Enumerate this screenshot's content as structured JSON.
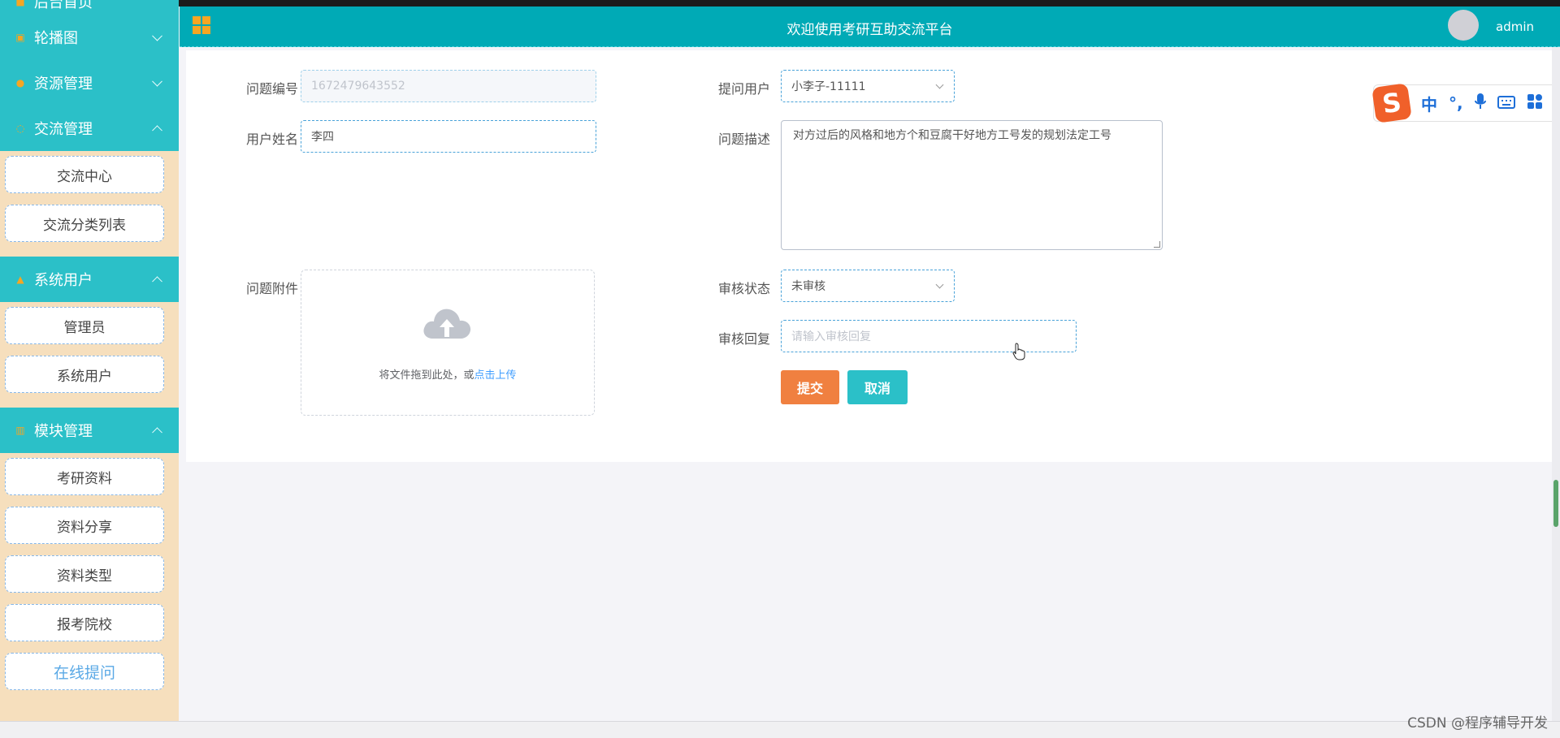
{
  "header": {
    "title": "欢迎使用考研互助交流平台",
    "username": "admin"
  },
  "sidebar": {
    "partial_top_label": "后台首页",
    "groups": [
      {
        "label": "轮播图",
        "icon": "image-icon",
        "expanded": false,
        "items": []
      },
      {
        "label": "资源管理",
        "icon": "location-pin-icon",
        "expanded": false,
        "items": []
      },
      {
        "label": "交流管理",
        "icon": "chat-icon",
        "expanded": true,
        "items": [
          "交流中心",
          "交流分类列表"
        ]
      },
      {
        "label": "系统用户",
        "icon": "user-icon",
        "expanded": true,
        "items": [
          "管理员",
          "系统用户"
        ]
      },
      {
        "label": "模块管理",
        "icon": "module-icon",
        "expanded": true,
        "items": [
          "考研资料",
          "资料分享",
          "资料类型",
          "报考院校",
          "在线提问"
        ]
      }
    ],
    "active_item": "在线提问"
  },
  "form": {
    "question_id": {
      "label": "问题编号",
      "value": "1672479643552"
    },
    "asker": {
      "label": "提问用户",
      "value": "小李子-11111"
    },
    "user_name": {
      "label": "用户姓名",
      "value": "李四"
    },
    "description": {
      "label": "问题描述",
      "value": "对方过后的风格和地方个和豆腐干好地方工号发的规划法定工号"
    },
    "attachment": {
      "label": "问题附件",
      "upload_text": "将文件拖到此处，或",
      "upload_link": "点击上传"
    },
    "review_status": {
      "label": "审核状态",
      "value": "未审核"
    },
    "review_reply": {
      "label": "审核回复",
      "placeholder": "请输入审核回复"
    },
    "submit_label": "提交",
    "cancel_label": "取消"
  },
  "ime": {
    "logo": "S",
    "buttons": [
      "中",
      "°,",
      "mic-icon",
      "keyboard-icon",
      "grid-icon"
    ]
  },
  "watermark": "CSDN @程序辅导开发",
  "colors": {
    "sidebar_head": "#2bc0c8",
    "header": "#00aab6",
    "submit": "#f08040",
    "cancel": "#2bc0c8",
    "sidebar_bg": "#f6dfbd"
  }
}
